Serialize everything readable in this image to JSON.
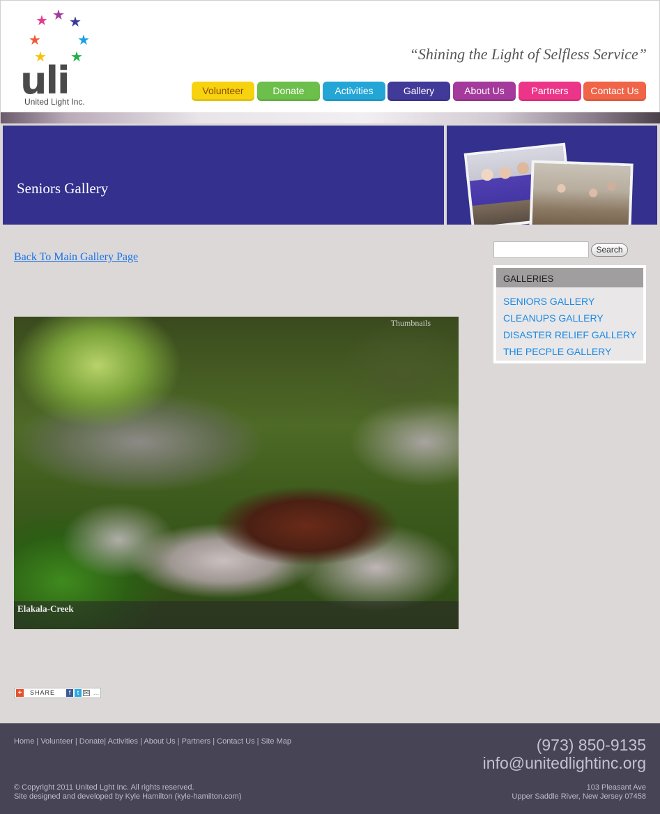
{
  "logo": {
    "word": "uli",
    "subtitle": "United Light Inc.",
    "star_colors": [
      "#e63a8c",
      "#3b3a9a",
      "#e8206e",
      "#1aa0e0",
      "#f05a3a",
      "#23b04a",
      "#f6c20a"
    ]
  },
  "header": {
    "tagline": "“Shining the Light of Selfless Service”"
  },
  "nav": [
    {
      "label": "Volunteer",
      "color": "#f7d20f",
      "text_color": "#8a4d00"
    },
    {
      "label": "Donate",
      "color": "#6cbf4a",
      "text_color": "#ffffff"
    },
    {
      "label": "Activities",
      "color": "#23a6d6",
      "text_color": "#ffffff"
    },
    {
      "label": "Gallery",
      "color": "#423a98",
      "text_color": "#ffffff"
    },
    {
      "label": "About Us",
      "color": "#a43a9c",
      "text_color": "#ffffff"
    },
    {
      "label": "Partners",
      "color": "#ec3588",
      "text_color": "#ffffff"
    },
    {
      "label": "Contact Us",
      "color": "#f06448",
      "text_color": "#ffffff"
    }
  ],
  "banner": {
    "title": "Seniors Gallery",
    "color": "#33308e"
  },
  "content": {
    "back_link": "Back To Main Gallery Page",
    "gallery": {
      "thumbnails_label": "Thumbnails",
      "caption": "Elakala-Creek"
    },
    "share": {
      "label": "SHARE"
    }
  },
  "sidebar": {
    "search_value": "",
    "search_button": "Search",
    "galleries_heading": "GALLERIES",
    "galleries": [
      "SENIORS GALLERY",
      "CLEANUPS GALLERY",
      "DISASTER RELIEF GALLERY",
      "THE PECPLE GALLERY"
    ]
  },
  "footer": {
    "links": [
      "Home",
      "Volunteer",
      "Donate",
      "Activities",
      "About Us",
      "Partners",
      "Contact Us",
      "Site Map"
    ],
    "phone": "(973) 850-9135",
    "email": "info@unitedlightinc.org",
    "copyright": "© Copyright 2011 United Lght Inc. All rights reserved.",
    "credit": "Site designed and developed by Kyle Hamilton (kyle-hamilton.com)",
    "address_line1": "103 Pleasant Ave",
    "address_line2": "Upper Saddle River, New Jersey 07458"
  }
}
